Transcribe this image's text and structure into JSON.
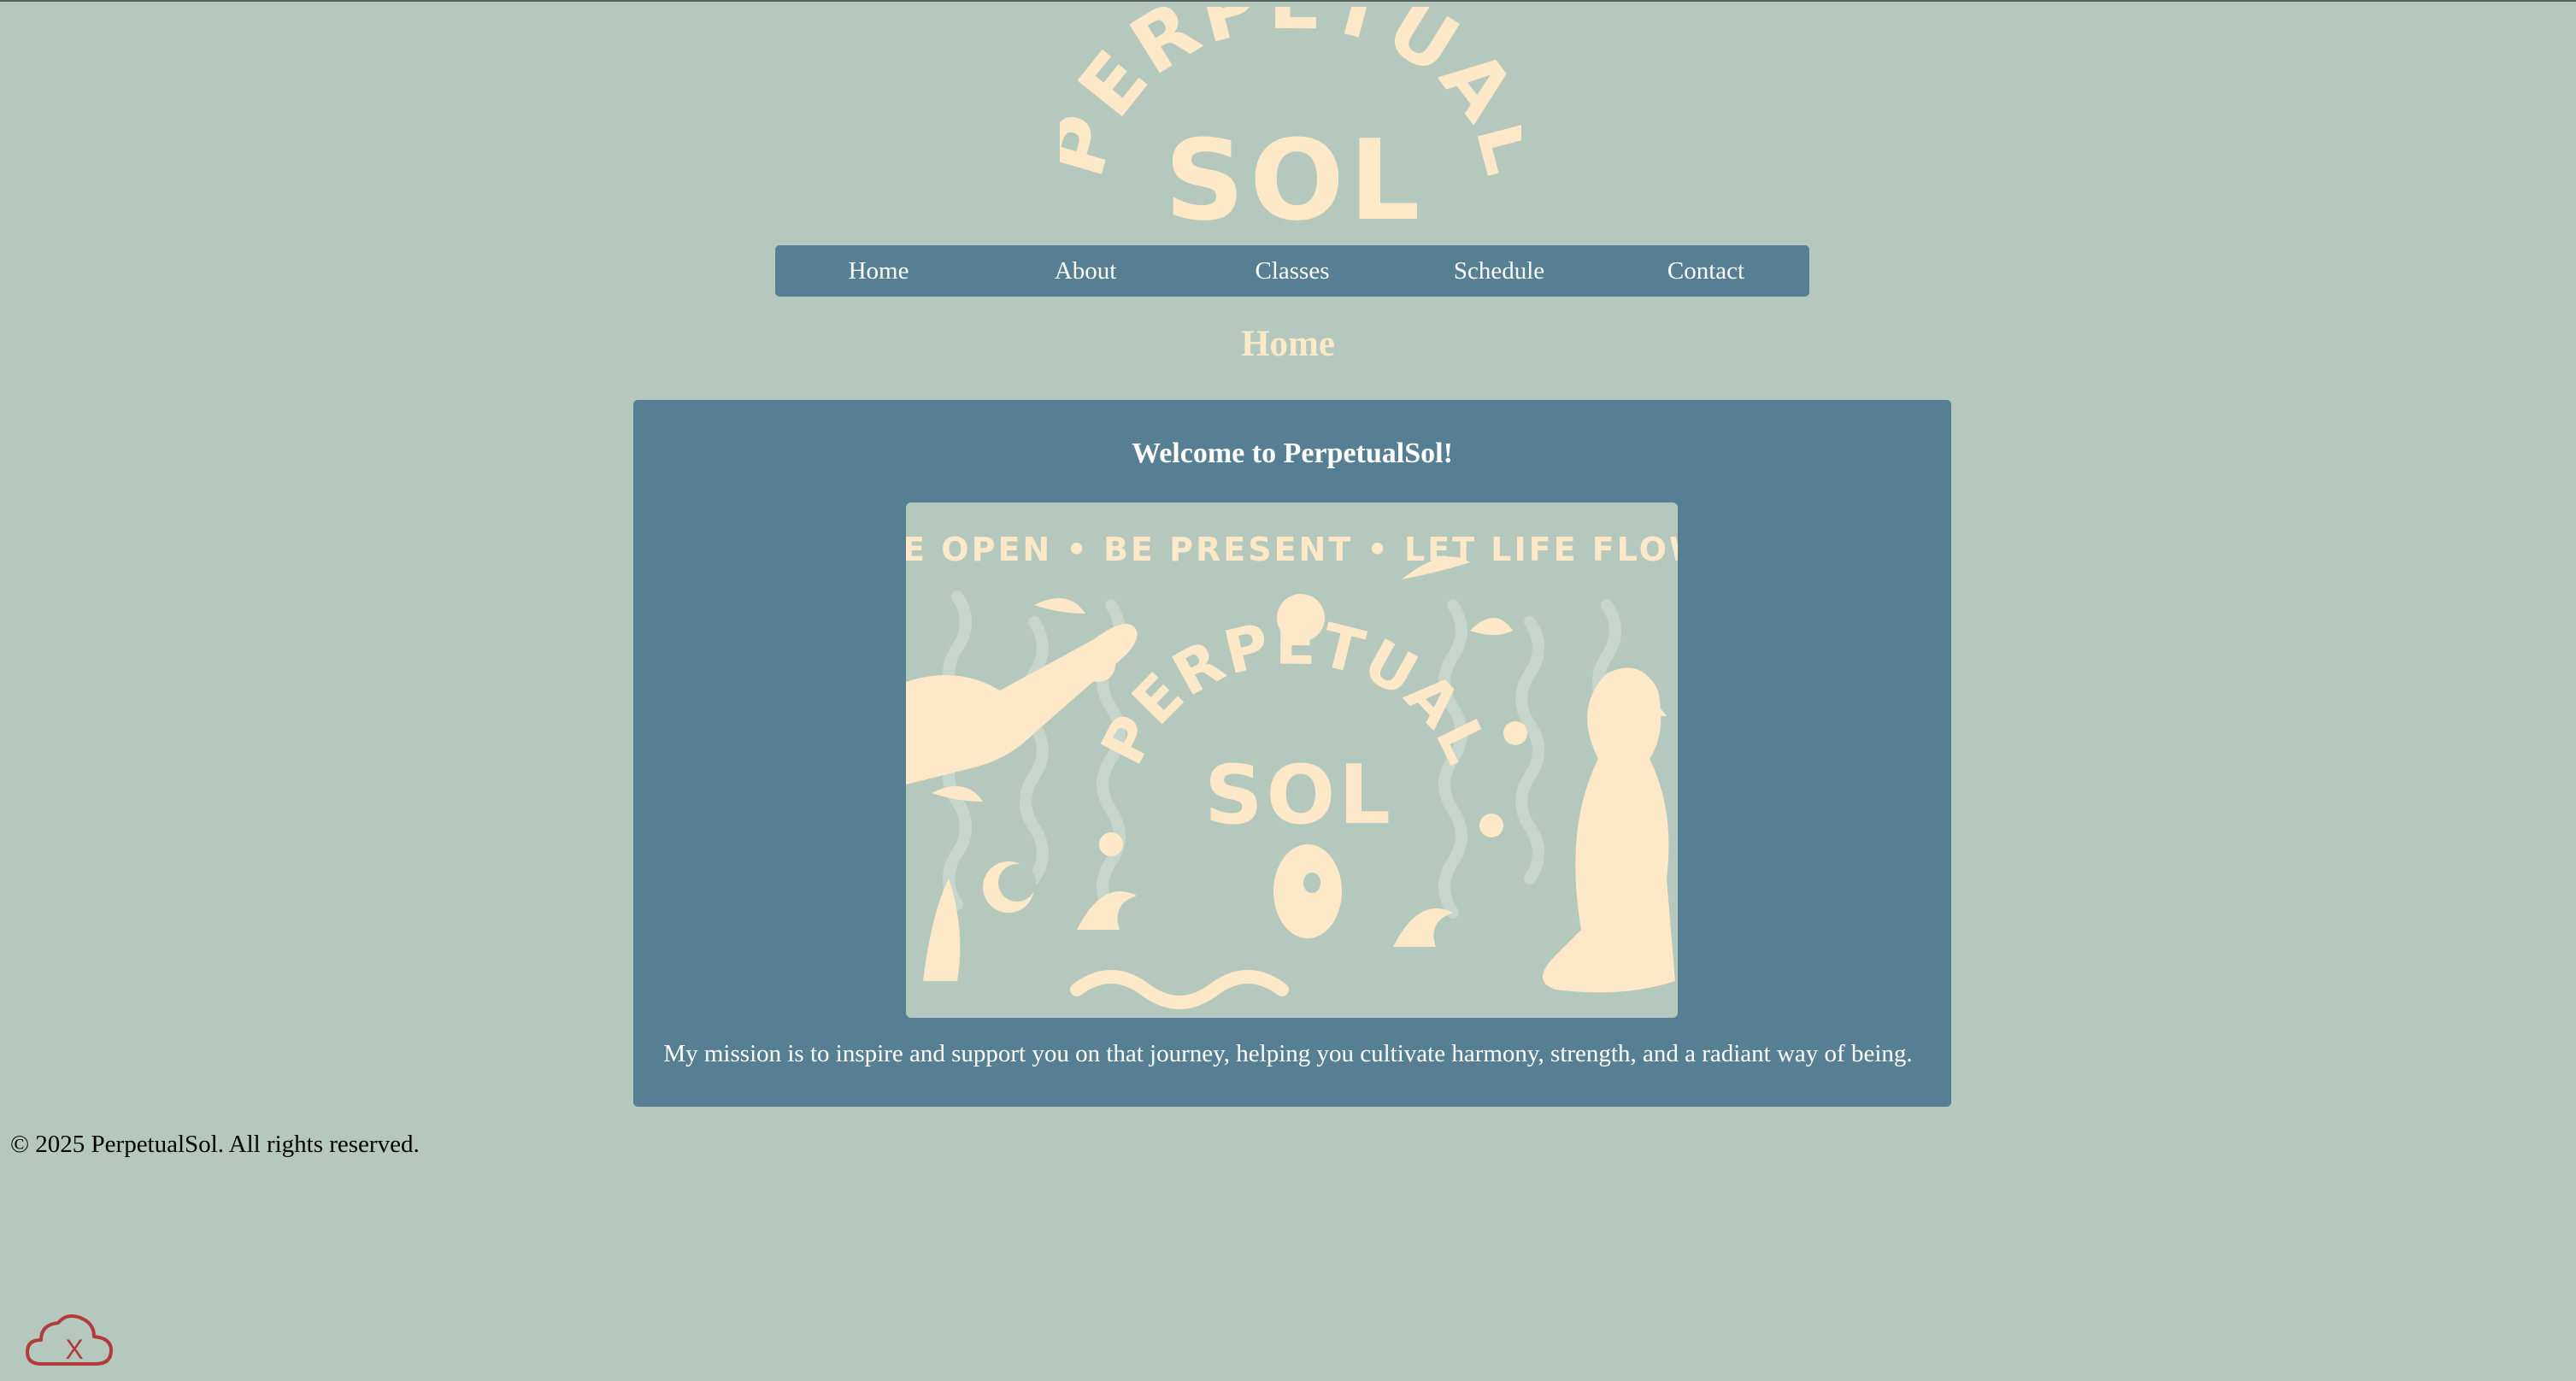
{
  "colors": {
    "background": "#b4c8bd",
    "accent": "#577f93",
    "cream": "#fde9c8",
    "error": "#b33a3a"
  },
  "logo": {
    "line1": "PERPETUAL",
    "line2": "SOL"
  },
  "nav": {
    "items": [
      {
        "label": "Home"
      },
      {
        "label": "About"
      },
      {
        "label": "Classes"
      },
      {
        "label": "Schedule"
      },
      {
        "label": "Contact"
      }
    ]
  },
  "page": {
    "heading": "Home"
  },
  "welcome": {
    "title": "Welcome to PerpetualSol!",
    "banner": {
      "motto": "BE OPEN • BE PRESENT • LET LIFE FLOW",
      "line1": "PERPETUAL",
      "line2": "SOL"
    },
    "mission": "My mission is to inspire and support you on that journey, helping you cultivate harmony, strength, and a radiant way of being."
  },
  "footer": {
    "copyright": "© 2025 PerpetualSol. All rights reserved."
  },
  "status": {
    "icon": "cloud-offline-icon",
    "mark": "X"
  }
}
